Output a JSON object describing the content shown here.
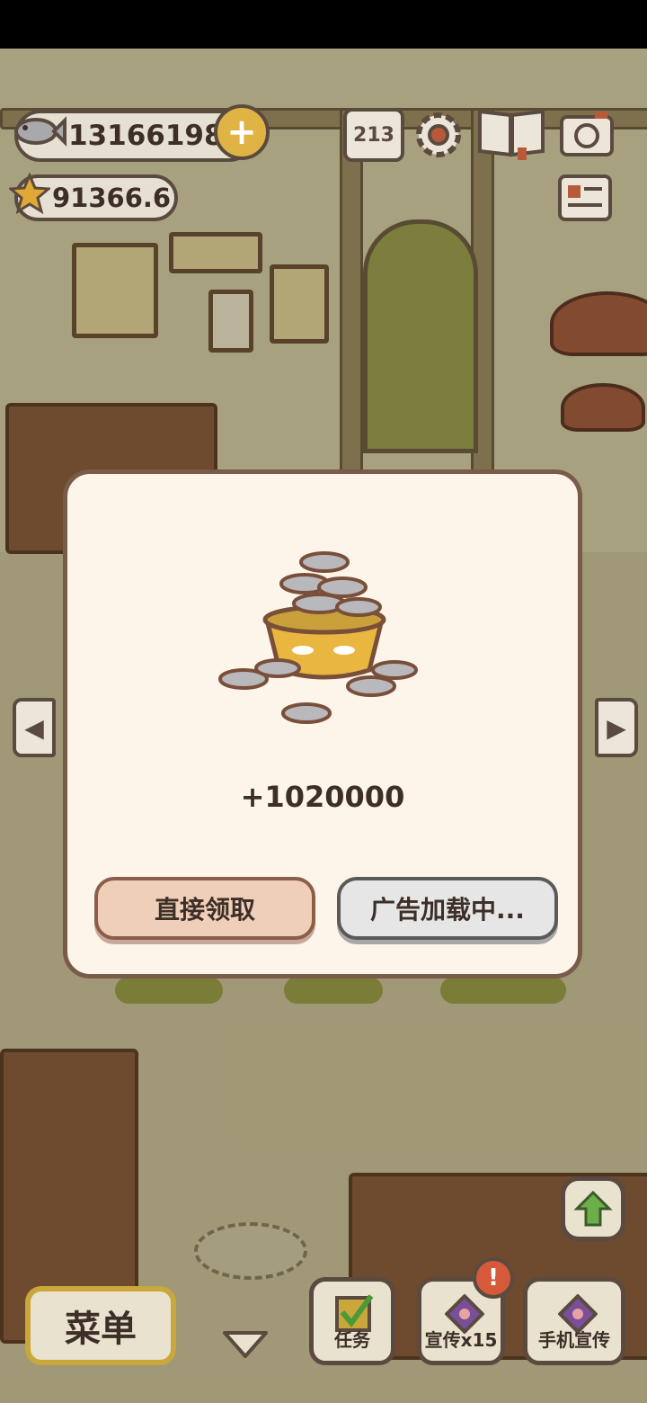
{
  "hud": {
    "fish_count": "13166198",
    "star_count": "91366.6",
    "ranking_icon_digits": "213"
  },
  "modal": {
    "reward_amount": "+1020000",
    "claim_button": "直接领取",
    "ad_button": "广告加载中..."
  },
  "bottom_bar": {
    "menu_button": "菜单",
    "tasks_button": "任务",
    "promote_button": "宣传x15",
    "phone_promote_button": "手机宣传",
    "alert_badge": "!"
  },
  "colors": {
    "modal_bg": "#fdf5ea",
    "claim_button_bg": "#f0cfba",
    "ad_button_bg": "#e6e6e6",
    "text": "#3d2f27",
    "gold": "#c9a73a"
  }
}
